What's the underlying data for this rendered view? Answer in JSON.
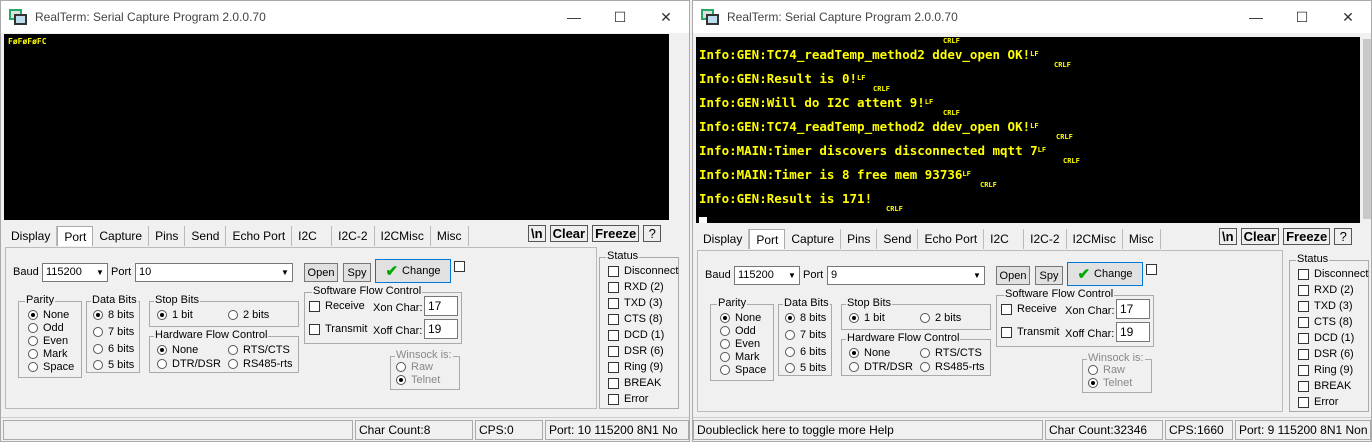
{
  "left": {
    "title": "RealTerm: Serial Capture Program 2.0.0.70",
    "terminal_text": "FøFøFøFC",
    "tabs": [
      "Display",
      "Port",
      "Capture",
      "Pins",
      "Send",
      "Echo Port",
      "I2C",
      "I2C-2",
      "I2CMisc",
      "Misc"
    ],
    "buttons": {
      "newline": "\\n",
      "clear": "Clear",
      "freeze": "Freeze",
      "help": "?"
    },
    "baud_label": "Baud",
    "baud": "115200",
    "port_label": "Port",
    "port": "10",
    "open": "Open",
    "spy": "Spy",
    "change": "Change",
    "parity": {
      "label": "Parity",
      "options": [
        "None",
        "Odd",
        "Even",
        "Mark",
        "Space"
      ],
      "selected": "None"
    },
    "databits": {
      "label": "Data Bits",
      "options": [
        "8 bits",
        "7 bits",
        "6 bits",
        "5 bits"
      ],
      "selected": "8 bits"
    },
    "stopbits": {
      "label": "Stop Bits",
      "options": [
        "1 bit",
        "2 bits"
      ],
      "selected": "1 bit"
    },
    "hwflow": {
      "label": "Hardware Flow Control",
      "options": [
        "None",
        "RTS/CTS",
        "DTR/DSR",
        "RS485-rts"
      ],
      "selected": "None"
    },
    "swflow": {
      "label": "Software Flow Control",
      "receive": "Receive",
      "transmit": "Transmit",
      "xon_label": "Xon Char:",
      "xon": "17",
      "xoff_label": "Xoff Char:",
      "xoff": "19"
    },
    "winsock": {
      "label": "Winsock is:",
      "options": [
        "Raw",
        "Telnet"
      ],
      "selected": "Telnet"
    },
    "status": {
      "label": "Status",
      "items": [
        "Disconnect",
        "RXD (2)",
        "TXD (3)",
        "CTS (8)",
        "DCD (1)",
        "DSR (6)",
        "Ring (9)",
        "BREAK",
        "Error"
      ]
    },
    "statusbar": {
      "help": "",
      "charcount": "Char Count:8",
      "cps": "CPS:0",
      "port": "Port: 10 115200 8N1 No"
    }
  },
  "right": {
    "title": "RealTerm: Serial Capture Program 2.0.0.70",
    "terminal_lines": [
      "Info:GEN:TC74_readTemp_method2 ddev_open OK!",
      "Info:GEN:Result is 0!",
      "Info:GEN:Will do I2C attent 9!",
      "Info:GEN:TC74_readTemp_method2 ddev_open OK!",
      "Info:MAIN:Timer discovers disconnected mqtt 7",
      "Info:MAIN:Timer is 8 free mem 93736",
      "Info:GEN:Result is 171!"
    ],
    "ctl_crlf": "CRLF",
    "ctl_lf": "LF",
    "tabs": [
      "Display",
      "Port",
      "Capture",
      "Pins",
      "Send",
      "Echo Port",
      "I2C",
      "I2C-2",
      "I2CMisc",
      "Misc"
    ],
    "buttons": {
      "newline": "\\n",
      "clear": "Clear",
      "freeze": "Freeze",
      "help": "?"
    },
    "baud_label": "Baud",
    "baud": "115200",
    "port_label": "Port",
    "port": "9",
    "open": "Open",
    "spy": "Spy",
    "change": "Change",
    "parity": {
      "label": "Parity",
      "options": [
        "None",
        "Odd",
        "Even",
        "Mark",
        "Space"
      ],
      "selected": "None"
    },
    "databits": {
      "label": "Data Bits",
      "options": [
        "8 bits",
        "7 bits",
        "6 bits",
        "5 bits"
      ],
      "selected": "8 bits"
    },
    "stopbits": {
      "label": "Stop Bits",
      "options": [
        "1 bit",
        "2 bits"
      ],
      "selected": "1 bit"
    },
    "hwflow": {
      "label": "Hardware Flow Control",
      "options": [
        "None",
        "RTS/CTS",
        "DTR/DSR",
        "RS485-rts"
      ],
      "selected": "None"
    },
    "swflow": {
      "label": "Software Flow Control",
      "receive": "Receive",
      "transmit": "Transmit",
      "xon_label": "Xon Char:",
      "xon": "17",
      "xoff_label": "Xoff Char:",
      "xoff": "19"
    },
    "winsock": {
      "label": "Winsock is:",
      "options": [
        "Raw",
        "Telnet"
      ],
      "selected": "Telnet"
    },
    "status": {
      "label": "Status",
      "items": [
        "Disconnect",
        "RXD (2)",
        "TXD (3)",
        "CTS (8)",
        "DCD (1)",
        "DSR (6)",
        "Ring (9)",
        "BREAK",
        "Error"
      ]
    },
    "statusbar": {
      "help": "Doubleclick here to toggle more Help",
      "charcount": "Char Count:32346",
      "cps": "CPS:1660",
      "port": "Port: 9 115200 8N1 Non"
    }
  },
  "icons": {
    "app": "realterm-app-icon",
    "minimize": "minimize-icon",
    "maximize": "maximize-icon",
    "close": "close-icon",
    "check": "green-check-icon",
    "dropdown": "chevron-down-icon"
  },
  "colors": {
    "terminal_bg": "#000000",
    "terminal_text": "#ffff00",
    "change_border": "#0078d7",
    "check_green": "#00aa00"
  }
}
